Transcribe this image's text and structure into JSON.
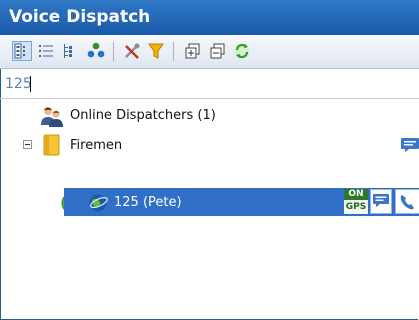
{
  "window": {
    "title": "Voice Dispatch"
  },
  "toolbar": {
    "buttons": [
      {
        "icon": "grid-view-icon"
      },
      {
        "icon": "list-view-icon"
      },
      {
        "icon": "tree-view-icon"
      },
      {
        "icon": "users-group-icon"
      },
      {
        "icon": "tools-icon"
      },
      {
        "icon": "filter-icon"
      },
      {
        "icon": "expand-all-icon"
      },
      {
        "icon": "collapse-all-icon"
      },
      {
        "icon": "refresh-icon"
      }
    ]
  },
  "search": {
    "value": "125"
  },
  "tree": {
    "online_dispatchers": "Online Dispatchers (1)",
    "group": "Firemen",
    "selected_user": "125 (Pete)",
    "gps_badge_top": "ON",
    "gps_badge_bottom": "GPS"
  },
  "colors": {
    "title_bar": "#1f62b0",
    "selection": "#2f6fc7",
    "search_text": "#5a84b8"
  }
}
